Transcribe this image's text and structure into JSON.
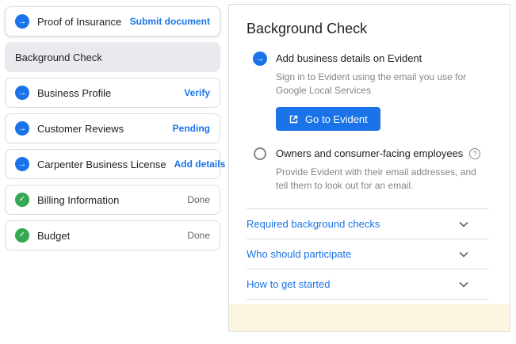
{
  "colors": {
    "accent": "#1a73e8",
    "success": "#34a853",
    "text": "#202124",
    "muted_text": "#80868b",
    "border": "#dadce0",
    "active_item_bg": "#e8eaed"
  },
  "sidebar": {
    "items": [
      {
        "label": "Proof of Insurance",
        "action": "Submit document",
        "icon": "arrow",
        "state": "in-progress"
      },
      {
        "label": "Background Check",
        "action": "",
        "icon": "none",
        "state": "active"
      },
      {
        "label": "Business Profile",
        "action": "Verify",
        "icon": "arrow",
        "state": "in-progress"
      },
      {
        "label": "Customer Reviews",
        "action": "Pending",
        "icon": "arrow",
        "state": "in-progress"
      },
      {
        "label": "Carpenter Business License",
        "action": "Add details",
        "icon": "arrow",
        "state": "in-progress"
      },
      {
        "label": "Billing Information",
        "action": "Done",
        "icon": "check",
        "state": "done"
      },
      {
        "label": "Budget",
        "action": "Done",
        "icon": "check",
        "state": "done"
      }
    ]
  },
  "panel": {
    "title": "Background Check",
    "option1": {
      "label": "Add business details on Evident",
      "description": "Sign in to Evident using the email you use for Google Local Services",
      "button_label": "Go to Evident",
      "selected": true
    },
    "option2": {
      "label": "Owners and consumer-facing employees",
      "description": "Provide Evident with their email addresses, and tell them to look out for an email.",
      "selected": false
    },
    "accordions": [
      {
        "label": "Required background checks"
      },
      {
        "label": "Who should participate"
      },
      {
        "label": "How to get started"
      }
    ]
  }
}
